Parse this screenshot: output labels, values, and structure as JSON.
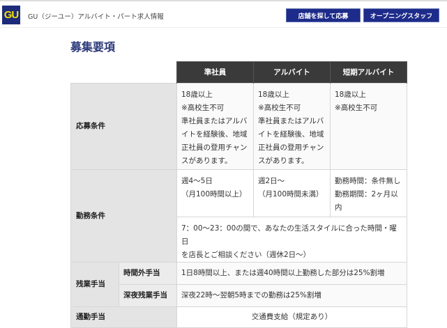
{
  "header": {
    "logo": "GU",
    "site_title": "GU（ジーユー）アルバイト・パート求人情報",
    "buttons": [
      "店舗を探して応募",
      "オープニングスタッフ"
    ]
  },
  "page_title": "募集要項",
  "table": {
    "columns": [
      "準社員",
      "アルバイト",
      "短期アルバイト"
    ],
    "rows": {
      "application": {
        "label": "応募条件",
        "cells": [
          [
            "18歳以上",
            "※高校生不可",
            "準社員またはアルバ",
            "イトを経験後、地域",
            "正社員の登用チャン",
            "スがあります。"
          ],
          [
            "18歳以上",
            "※高校生不可",
            "準社員またはアルバ",
            "イトを経験後、地域",
            "正社員の登用チャン",
            "スがあります。"
          ],
          [
            "18歳以上",
            "※高校生不可"
          ]
        ]
      },
      "work": {
        "label": "勤務条件",
        "cells": [
          [
            "週4～5日",
            "（月100時間以上）"
          ],
          [
            "週2日～",
            "（月100時間未満）"
          ],
          [
            "勤務時間：条件無し",
            "勤務期間：2ヶ月以",
            "内"
          ]
        ],
        "common": [
          "7：00～23：00の間で、あなたの生活スタイルに合った時間・曜日",
          "を店長とご相談ください（週休2日～）"
        ]
      },
      "overtime": {
        "label": "残業手当",
        "sub": [
          {
            "label": "時間外手当",
            "value": "1日8時間以上、または週40時間以上勤務した部分は25%割増"
          },
          {
            "label": "深夜残業手当",
            "value": "深夜22時～翌朝5時までの勤務は25%割増"
          }
        ]
      },
      "commute": {
        "label": "通勤手当",
        "value": "交通費支給（規定あり）"
      }
    }
  }
}
